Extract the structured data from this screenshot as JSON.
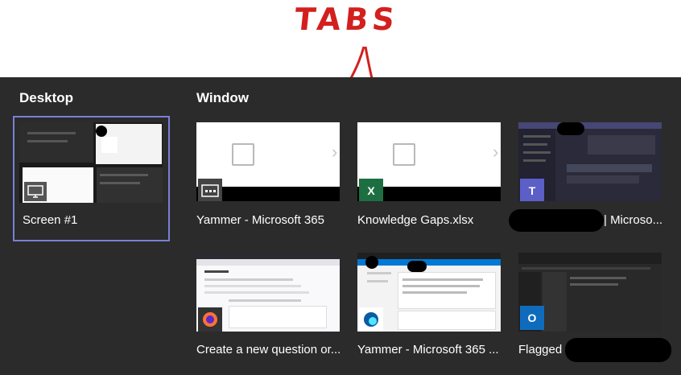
{
  "annotation": {
    "text": "TABS"
  },
  "sections": {
    "desktop_title": "Desktop",
    "window_title": "Window"
  },
  "desktop": [
    {
      "caption": "Screen #1"
    }
  ],
  "windows": [
    {
      "caption": "Yammer - Microsoft 365",
      "app_icon": "yammer-window-icon"
    },
    {
      "caption": "Knowledge Gaps.xlsx",
      "app_icon": "excel-icon"
    },
    {
      "caption": "| Microso...",
      "app_icon": "teams-icon"
    },
    {
      "caption": "Create a new question or...",
      "app_icon": "firefox-icon"
    },
    {
      "caption": "Yammer - Microsoft 365 ...",
      "app_icon": "edge-icon"
    },
    {
      "caption": "Flagged",
      "app_icon": "outlook-icon"
    }
  ],
  "colors": {
    "picker_bg": "#2b2b2b",
    "selected_border": "#7b7fd6",
    "annotation": "#d3201e",
    "excel_green": "#1d6f42",
    "teams_purple": "#5b5fc7",
    "outlook_blue": "#0f6cbd"
  }
}
